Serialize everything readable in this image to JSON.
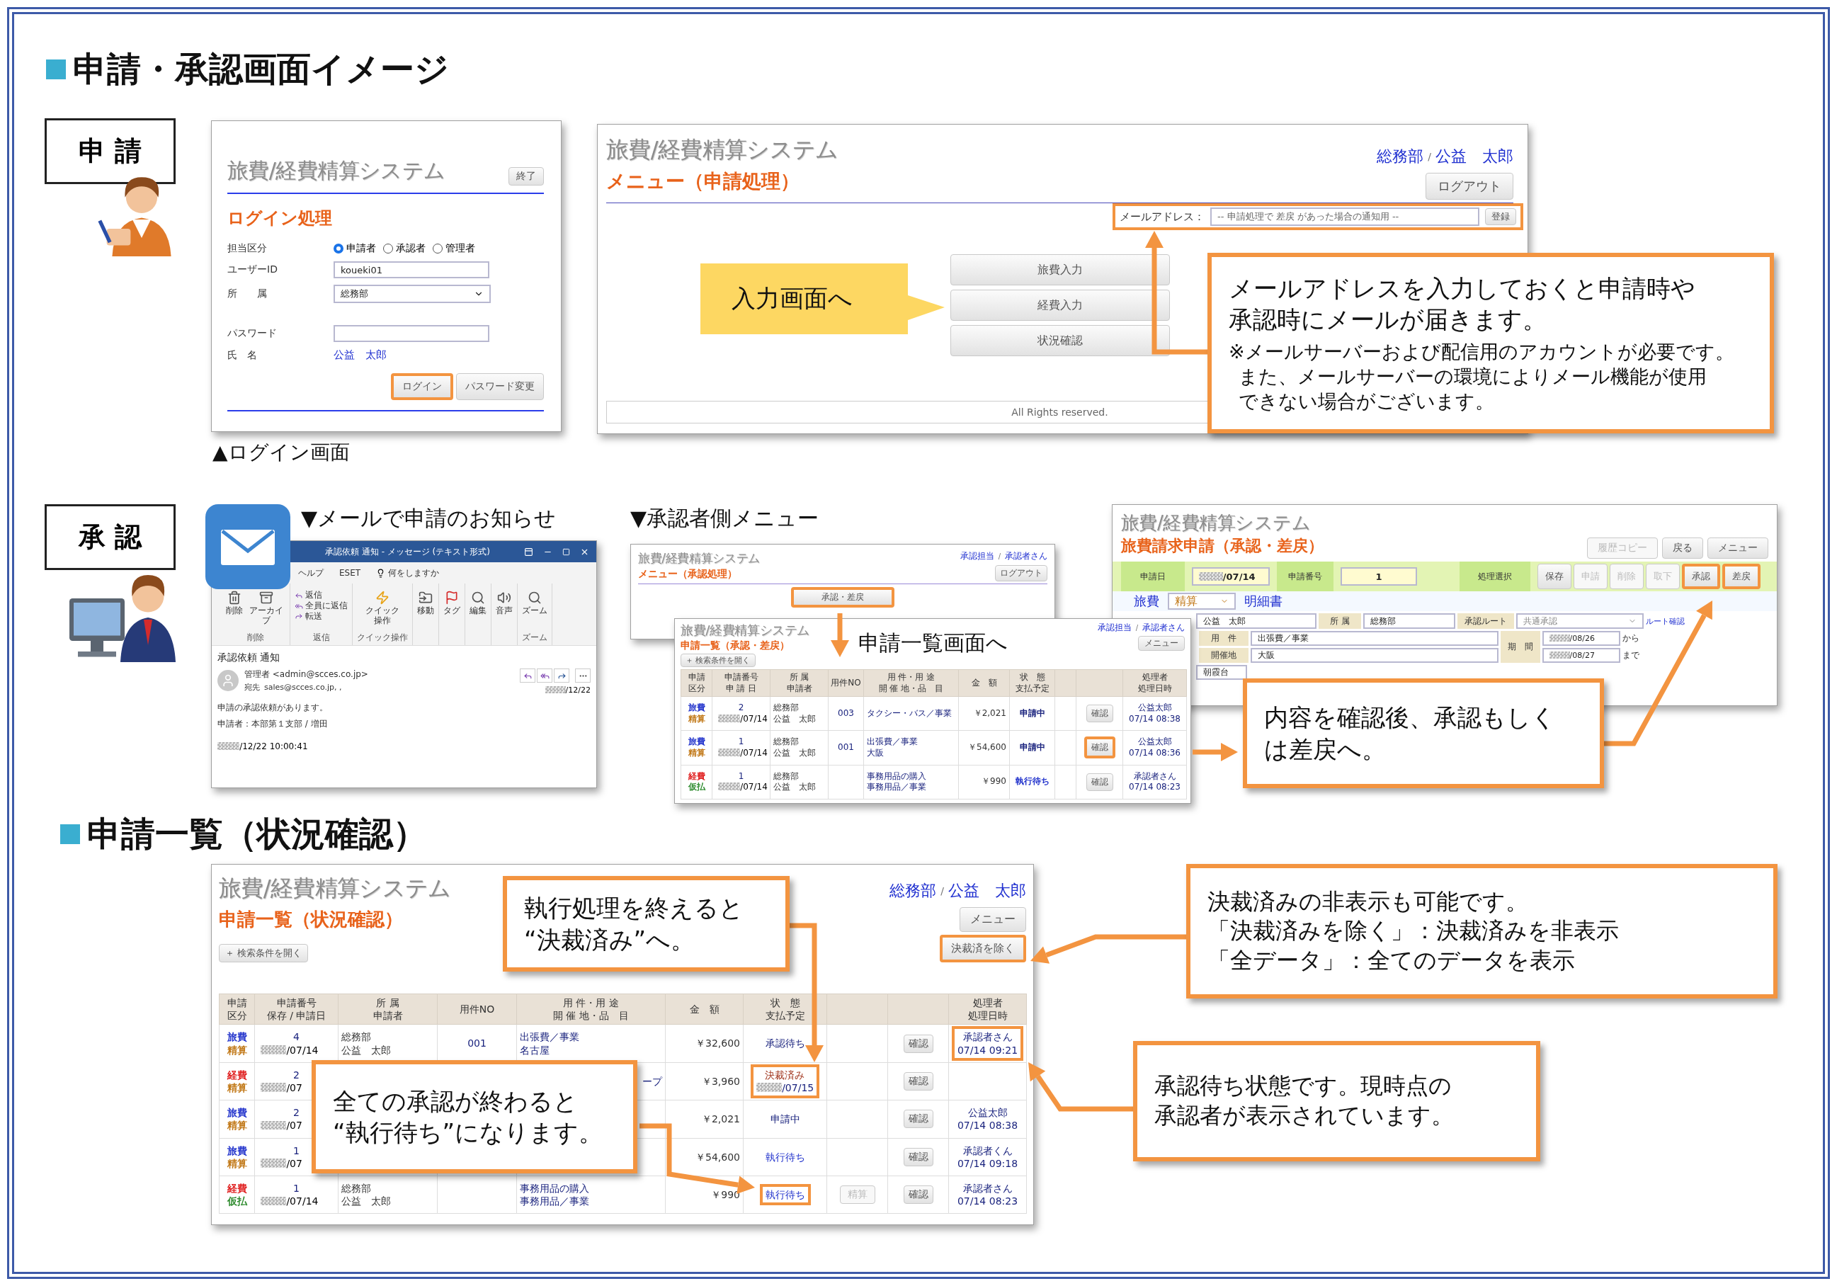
{
  "page_title": "申請・承認画面イメージ",
  "apply": {
    "role_label": "申 請",
    "login": {
      "app_title": "旅費/経費精算システム",
      "exit_button": "終了",
      "heading": "ログイン処理",
      "role_label": "担当区分",
      "roles": [
        {
          "label": "申請者",
          "selected": true
        },
        {
          "label": "承認者",
          "selected": false
        },
        {
          "label": "管理者",
          "selected": false
        }
      ],
      "user_id_label": "ユーザーID",
      "user_id": "koueki01",
      "dept_label": "所　　属",
      "dept": "総務部",
      "password_label": "パスワード",
      "name_label": "氏　名",
      "name": "公益　太郎",
      "login_button": {
        "label": "ログイン",
        "highlighted": true
      },
      "password_change_button": {
        "label": "パスワード変更",
        "highlighted": false
      }
    },
    "login_caption": "▲ログイン画面",
    "menu": {
      "app_title": "旅費/経費精算システム",
      "heading": "メニュー（申請処理）",
      "dept": "総務部",
      "separator": "/",
      "user": "公益　太郎",
      "logout_button": "ログアウト",
      "mail_label": "メールアドレス：",
      "mail_placeholder": "-- 申請処理で 差戻 があった場合の通知用 --",
      "register_button": "登録",
      "mail_highlighted": true,
      "buttons": [
        "旅費入力",
        "経費入力",
        "状況確認"
      ],
      "footer": "All Rights reserved."
    },
    "input_callout": "入力画面へ",
    "mail_callout": {
      "lines": [
        "メールアドレスを入力しておくと申請時や",
        "承認時にメールが届きます。"
      ],
      "notes": [
        "※メールサーバーおよび配信用のアカウントが必要です。",
        "また、メールサーバーの環境によりメール機能が使用",
        "できない場合がございます。"
      ]
    }
  },
  "approve": {
    "role_label": "承 認",
    "mail_caption": "▼メールで申請のお知らせ",
    "mail_window": {
      "title": "承認依頼 通知 - メッセージ (テキスト形式)",
      "tabs": [
        "ヘルプ",
        "ESET"
      ],
      "tell_me": "何をしますか",
      "groups": [
        {
          "label": "削除",
          "buttons": [
            {
              "kind": "delete",
              "label": "削除"
            },
            {
              "kind": "archive",
              "label": "アーカイブ"
            }
          ]
        },
        {
          "label": "返信",
          "buttons": [
            {
              "kind": "reply",
              "label": "返信"
            },
            {
              "kind": "reply_all",
              "label": "全員に返信"
            },
            {
              "kind": "forward",
              "label": "転送"
            }
          ]
        },
        {
          "label": "クイック操作",
          "buttons": [
            {
              "kind": "quick",
              "label": "クイック操作"
            }
          ]
        },
        {
          "buttons": [
            {
              "kind": "move",
              "label": "移動"
            }
          ]
        },
        {
          "buttons": [
            {
              "kind": "tag",
              "label": "タグ"
            }
          ]
        },
        {
          "buttons": [
            {
              "kind": "edit",
              "label": "編集"
            }
          ]
        },
        {
          "buttons": [
            {
              "kind": "voice",
              "label": "音声"
            }
          ]
        },
        {
          "label": "ズーム",
          "buttons": [
            {
              "kind": "zoom",
              "label": "ズーム"
            }
          ]
        }
      ],
      "subject": "承認依頼 通知",
      "sender": "管理者 <admin@scces.co.jp>",
      "to_label": "宛先",
      "to": "sales@scces.co.jp, ,",
      "date": "/12/22",
      "body": [
        "申請の承認依頼があります。",
        "申請者：本部第１支部 / 増田"
      ],
      "sent": "/12/22 10:00:41"
    },
    "menu_caption": "▼承認者側メニュー",
    "approver_menu": {
      "app_title": "旅費/経費精算システム",
      "heading": "メニュー（承認処理）",
      "role": "承認担当",
      "separator": "/",
      "user": "承認者さん",
      "logout_button": "ログアウト",
      "approve_button": {
        "label": "承認・差戻",
        "highlighted": true
      }
    },
    "list_arrow_label": "申請一覧画面へ",
    "approval_list": {
      "app_title": "旅費/経費精算システム",
      "heading": "申請一覧（承認・差戻）",
      "role": "承認担当",
      "separator": "/",
      "user": "承認者さん",
      "menu_button": "メニュー",
      "search_toggle": "＋ 検索条件を開く",
      "columns": [
        [
          "申請",
          "区分"
        ],
        [
          "申請番号",
          "申 請 日"
        ],
        [
          "所 属",
          "申請者"
        ],
        [
          "用件NO"
        ],
        [
          "用 件・用 途",
          "開 催 地・品　目"
        ],
        [
          "金　額"
        ],
        [
          "状　態",
          "支払予定"
        ],
        [],
        [],
        [
          "処理者",
          "処理日時"
        ]
      ],
      "rows": [
        {
          "category": {
            "text": "旅費",
            "color": "#2233cc"
          },
          "type": {
            "text": "精算",
            "color": "#c27a1a"
          },
          "number": "2",
          "date": "/07/14",
          "dept": "総務部",
          "applicant": "公益　太郎",
          "case_no": "003",
          "purpose": [
            "タクシー・バス／事業"
          ],
          "amount": "￥2,021",
          "status": {
            "text": "申請中",
            "color": "#1a237e",
            "highlighted": false
          },
          "confirm": {
            "label": "確認",
            "highlighted": false
          },
          "processor": {
            "lines": [
              "公益太郎",
              "07/14 08:38"
            ],
            "highlighted": false
          }
        },
        {
          "category": {
            "text": "旅費",
            "color": "#2233cc"
          },
          "type": {
            "text": "精算",
            "color": "#c27a1a"
          },
          "number": "1",
          "date": "/07/14",
          "dept": "総務部",
          "applicant": "公益　太郎",
          "case_no": "001",
          "purpose": [
            "出張費／事業",
            "大阪"
          ],
          "amount": "￥54,600",
          "status": {
            "text": "申請中",
            "color": "#1a237e",
            "highlighted": false
          },
          "confirm": {
            "label": "確認",
            "highlighted": true
          },
          "processor": {
            "lines": [
              "公益太郎",
              "07/14 08:36"
            ],
            "highlighted": false
          }
        },
        {
          "category": {
            "text": "経費",
            "color": "#e02020"
          },
          "type": {
            "text": "仮払",
            "color": "#2e8b2e"
          },
          "number": "1",
          "date": "/07/14",
          "dept": "総務部",
          "applicant": "公益　太郎",
          "purpose": [
            "事務用品の購入",
            "事務用品／事業"
          ],
          "amount": "￥990",
          "status": {
            "text": "執行待ち",
            "color": "#2233cc",
            "highlighted": false
          },
          "confirm": {
            "label": "確認",
            "highlighted": false
          },
          "processor": {
            "lines": [
              "承認者さん",
              "07/14 08:23"
            ],
            "highlighted": false
          }
        }
      ]
    },
    "approval_form": {
      "app_title": "旅費/経費精算システム",
      "heading": "旅費請求申請（承認・差戻）",
      "top_buttons": [
        {
          "label": "履歴コピー",
          "disabled": true
        },
        {
          "label": "戻る",
          "disabled": false
        },
        {
          "label": "メニュー",
          "disabled": false
        }
      ],
      "date_label": "申請日",
      "date": "/07/14",
      "number_label": "申請番号",
      "number": "1",
      "action_label": "処理選択",
      "actions": [
        {
          "label": "保存",
          "disabled": false,
          "highlighted": false
        },
        {
          "label": "申請",
          "disabled": true,
          "highlighted": false
        },
        {
          "label": "削除",
          "disabled": true,
          "highlighted": false
        },
        {
          "label": "取下",
          "disabled": true,
          "highlighted": false
        },
        {
          "label": "承認",
          "disabled": false,
          "highlighted": true
        },
        {
          "label": "差戻",
          "disabled": false,
          "highlighted": true
        }
      ],
      "expense_type": "旅費",
      "settlement": "精算",
      "detail_label": "明細書",
      "name": "公益　太郎",
      "dept_label": "所 属",
      "dept": "総務部",
      "route_label": "承認ルート",
      "route": "共通承認",
      "route_link": "ルート確認",
      "purpose_label": "用　件",
      "purpose": "出張費／事業",
      "venue_label": "開催地",
      "venue": "大阪",
      "period_label": "期　間",
      "period_from": "/08/26",
      "from_suffix": "から",
      "period_to": "/08/27",
      "to_suffix": "まで",
      "address": "朝霞台"
    },
    "callout": [
      "内容を確認後、承認もしく",
      "は差戻へ。"
    ]
  },
  "status": {
    "title": "申請一覧（状況確認）",
    "screen": {
      "app_title": "旅費/経費精算システム",
      "heading": "申請一覧（状況確認）",
      "dept": "総務部",
      "separator": "/",
      "user": "公益　太郎",
      "menu_button": "メニュー",
      "search_toggle": "＋ 検索条件を開く",
      "exclude_button": {
        "label": "決裁済を除く",
        "highlighted": true
      },
      "columns": [
        [
          "申請",
          "区分"
        ],
        [
          "申請番号",
          "保存 / 申請日"
        ],
        [
          "所 属",
          "申請者"
        ],
        [
          "用件NO"
        ],
        [
          "用 件・用 途",
          "開 催 地・品　目"
        ],
        [
          "金　額"
        ],
        [
          "状　態",
          "支払予定"
        ],
        [],
        [],
        [
          "処理者",
          "処理日時"
        ]
      ],
      "rows": [
        {
          "category": {
            "text": "旅費",
            "color": "#2233cc"
          },
          "type": {
            "text": "精算",
            "color": "#c27a1a"
          },
          "number": "4",
          "date": "/07/14",
          "dept": "総務部",
          "applicant": "公益　太郎",
          "case_no": "001",
          "purpose": [
            "出張費／事業",
            "名古屋"
          ],
          "amount": "￥32,600",
          "status": {
            "text": "承認待ち",
            "color": "#1a237e",
            "highlighted": false
          },
          "confirm": {
            "label": "確認",
            "highlighted": false
          },
          "processor": {
            "lines": [
              "承認者さん",
              "07/14 09:21"
            ],
            "highlighted": true
          }
        },
        {
          "category": {
            "text": "経費",
            "color": "#e02020"
          },
          "type": {
            "text": "精算",
            "color": "#c27a1a"
          },
          "number": "2",
          "date": "/07",
          "purpose": [
            "ープ"
          ],
          "amount": "￥3,960",
          "status": {
            "text": "決裁済み",
            "color": "#a0341c",
            "payment_date": "/07/15",
            "highlighted": true
          },
          "confirm": {
            "label": "確認",
            "highlighted": false
          }
        },
        {
          "category": {
            "text": "旅費",
            "color": "#2233cc"
          },
          "type": {
            "text": "精算",
            "color": "#c27a1a"
          },
          "number": "2",
          "date": "/07",
          "amount": "￥2,021",
          "status": {
            "text": "申請中",
            "color": "#1a237e",
            "highlighted": false
          },
          "confirm": {
            "label": "確認",
            "highlighted": false
          },
          "processor": {
            "lines": [
              "公益太郎",
              "07/14 08:38"
            ],
            "highlighted": false
          }
        },
        {
          "category": {
            "text": "旅費",
            "color": "#2233cc"
          },
          "type": {
            "text": "精算",
            "color": "#c27a1a"
          },
          "number": "1",
          "date": "/07",
          "amount": "￥54,600",
          "status": {
            "text": "執行待ち",
            "color": "#2233cc",
            "highlighted": false
          },
          "confirm": {
            "label": "確認",
            "highlighted": false
          },
          "processor": {
            "lines": [
              "承認者くん",
              "07/14 09:18"
            ],
            "highlighted": false
          }
        },
        {
          "category": {
            "text": "経費",
            "color": "#e02020"
          },
          "type": {
            "text": "仮払",
            "color": "#2e8b2e"
          },
          "number": "1",
          "date": "/07/14",
          "dept": "総務部",
          "applicant": "公益　太郎",
          "purpose": [
            "事務用品の購入",
            "事務用品／事業"
          ],
          "amount": "￥990",
          "status": {
            "text": "執行待ち",
            "color": "#2233cc",
            "highlighted": true
          },
          "extra_button": {
            "label": "精算",
            "disabled": true
          },
          "confirm": {
            "label": "確認",
            "highlighted": false
          },
          "processor": {
            "lines": [
              "承認者さん",
              "07/14 08:23"
            ],
            "highlighted": false
          }
        }
      ]
    },
    "callouts": [
      {
        "lines": [
          "執行処理を終えると",
          "“決裁済み”へ。"
        ]
      },
      {
        "lines": [
          "全ての承認が終わると",
          "“執行待ち”になります。"
        ]
      },
      {
        "lines": [
          "決裁済みの非表示も可能です。",
          "「決裁済みを除く」：決裁済みを非表示",
          "「全データ」：全てのデータを表示"
        ]
      },
      {
        "lines": [
          "承認待ち状態です。現時点の",
          "承認者が表示されています。"
        ]
      }
    ]
  }
}
